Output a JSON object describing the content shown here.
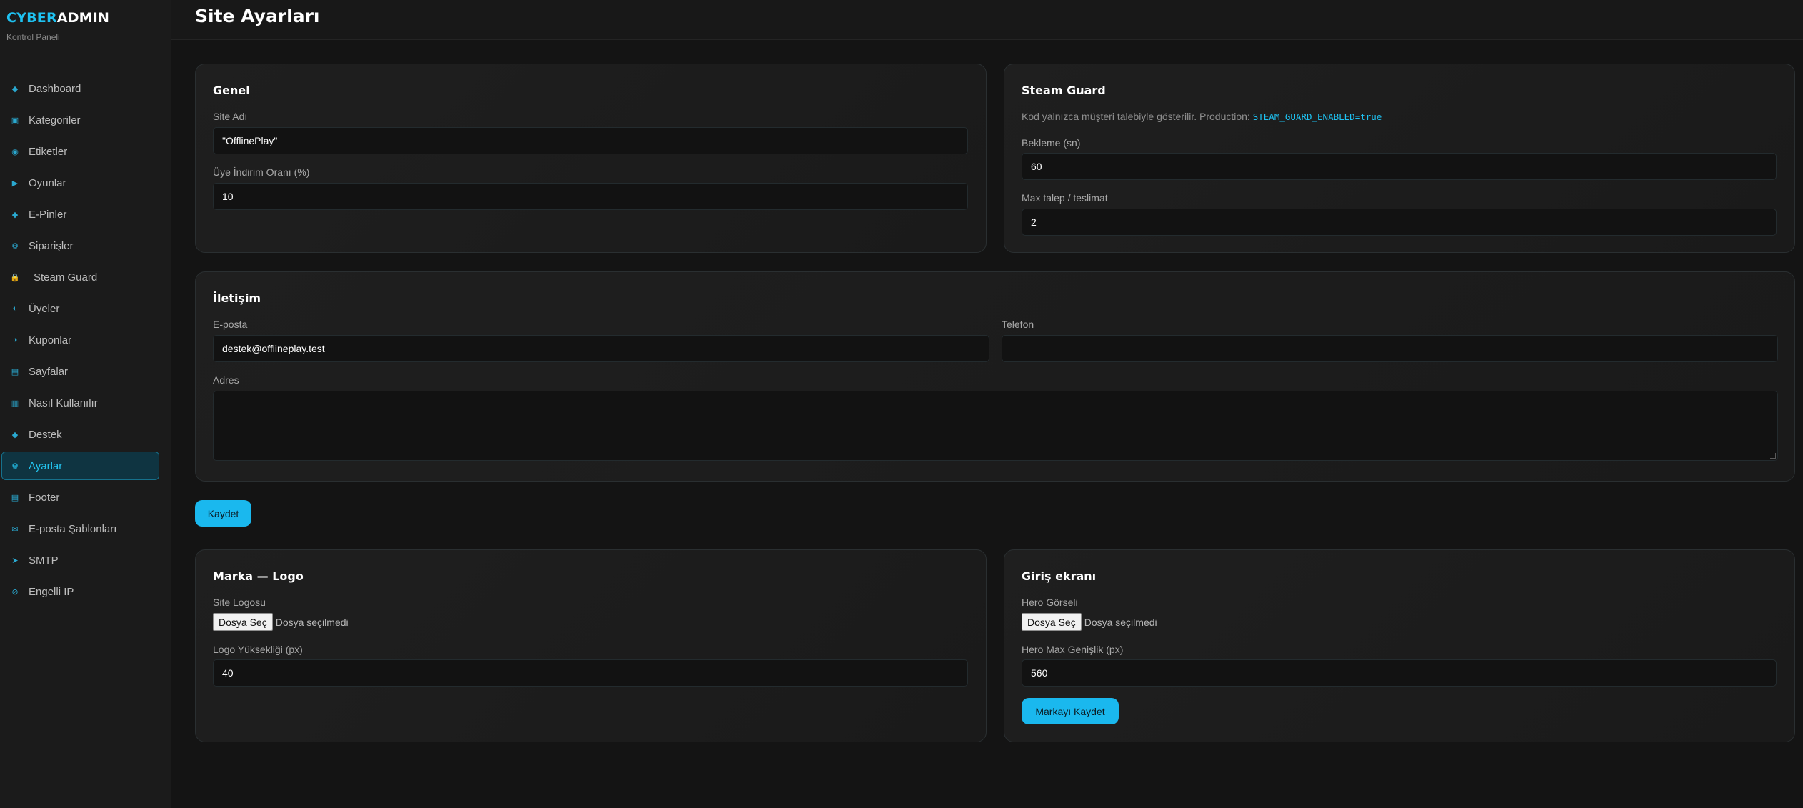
{
  "brand": {
    "part1": "CYBER",
    "part2": "ADMIN",
    "subtitle": "Kontrol Paneli"
  },
  "page": {
    "title": "Site Ayarları"
  },
  "nav": [
    {
      "label": "Dashboard",
      "icon": "diamond-icon",
      "glyph": "◆"
    },
    {
      "label": "Kategoriler",
      "icon": "folder-icon",
      "glyph": "▣"
    },
    {
      "label": "Etiketler",
      "icon": "tag-icon",
      "glyph": "◉"
    },
    {
      "label": "Oyunlar",
      "icon": "play-icon",
      "glyph": "▶"
    },
    {
      "label": "E-Pinler",
      "icon": "diamond-icon",
      "glyph": "◆"
    },
    {
      "label": "Siparişler",
      "icon": "gear-icon",
      "glyph": "⚙"
    },
    {
      "label": "Steam Guard",
      "icon": "lock-icon",
      "glyph": "🔒"
    },
    {
      "label": "Üyeler",
      "icon": "user-icon",
      "glyph": "◐"
    },
    {
      "label": "Kuponlar",
      "icon": "coupon-icon",
      "glyph": "◑"
    },
    {
      "label": "Sayfalar",
      "icon": "page-icon",
      "glyph": "▤"
    },
    {
      "label": "Nasıl Kullanılır",
      "icon": "book-icon",
      "glyph": "▥"
    },
    {
      "label": "Destek",
      "icon": "support-icon",
      "glyph": "◆"
    },
    {
      "label": "Ayarlar",
      "icon": "settings-icon",
      "glyph": "⚙"
    },
    {
      "label": "Footer",
      "icon": "footer-icon",
      "glyph": "▤"
    },
    {
      "label": "E-posta Şablonları",
      "icon": "mail-icon",
      "glyph": "✉"
    },
    {
      "label": "SMTP",
      "icon": "send-icon",
      "glyph": "➤"
    },
    {
      "label": "Engelli IP",
      "icon": "block-icon",
      "glyph": "⊘"
    }
  ],
  "active_nav": "Ayarlar",
  "general": {
    "title": "Genel",
    "site_name_label": "Site Adı",
    "site_name_value": "\"OfflinePlay\"",
    "discount_label": "Üye İndirim Oranı (%)",
    "discount_value": "10"
  },
  "steam_guard": {
    "title": "Steam Guard",
    "note": "Kod yalnızca müşteri talebiyle gösterilir. Production:",
    "note_code": "STEAM_GUARD_ENABLED=true",
    "cooldown_label": "Bekleme (sn)",
    "cooldown_value": "60",
    "max_label": "Max talep / teslimat",
    "max_value": "2"
  },
  "contact": {
    "title": "İletişim",
    "email_label": "E-posta",
    "email_value": "destek@offlineplay.test",
    "phone_label": "Telefon",
    "phone_value": "",
    "address_label": "Adres",
    "address_value": ""
  },
  "save_button": "Kaydet",
  "brand_logo": {
    "title": "Marka — Logo",
    "logo_label": "Site Logosu",
    "file_button": "Dosya Seç",
    "file_status": "Dosya seçilmedi",
    "height_label": "Logo Yüksekliği (px)",
    "height_value": "40"
  },
  "login_screen": {
    "title": "Giriş ekranı",
    "hero_label": "Hero Görseli",
    "file_button": "Dosya Seç",
    "file_status": "Dosya seçilmedi",
    "width_label": "Hero Max Genişlik (px)",
    "width_value": "560",
    "save_button": "Markayı Kaydet"
  },
  "colors": {
    "accent": "#1ec2f2",
    "background": "#141414",
    "sidebar": "#1b1b1b"
  }
}
